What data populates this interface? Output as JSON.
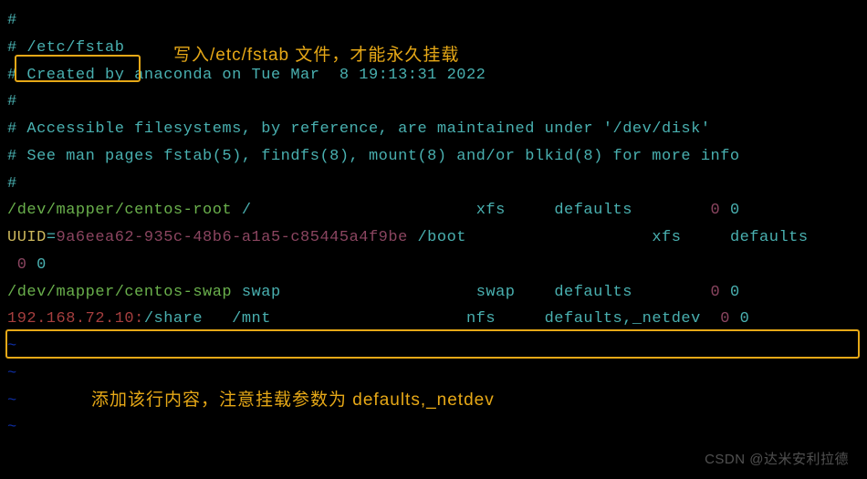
{
  "annotations": {
    "top": "写入/etc/fstab 文件，才能永久挂载",
    "bottom": "添加该行内容，注意挂载参数为 defaults,_netdev"
  },
  "lines": {
    "l1": "#",
    "l2_hash": "# ",
    "l2_path": "/etc/fstab",
    "l3": "# Created by anaconda on Tue Mar  8 19:13:31 2022",
    "l4": "#",
    "l5": "# Accessible filesystems, by reference, are maintained under '/dev/disk'",
    "l6": "# See man pages fstab(5), findfs(8), mount(8) and/or blkid(8) for more info",
    "l7": "#",
    "l8_dev": "/dev/mapper/centos-root",
    "l8_mnt": " /                       ",
    "l8_fs": "xfs     ",
    "l8_opts": "defaults        ",
    "l8_dump": "0",
    "l8_pass": " 0",
    "l9_uuid_label": "UUID",
    "l9_eq": "=",
    "l9_uuid_val": "9a6eea62-935c-48b6-a1a5-c85445a4f9be",
    "l9_mnt": " /boot                   ",
    "l9_fs": "xfs     ",
    "l9_opts": "defaults  ",
    "l10_dump": " 0",
    "l10_pass": " 0",
    "l11_dev": "/dev/mapper/centos-swap",
    "l11_mnt": " swap                    ",
    "l11_fs": "swap    ",
    "l11_opts": "defaults        ",
    "l11_dump": "0",
    "l11_pass": " 0",
    "l12_host": "192.168.72.10:",
    "l12_share": "/share   /mnt                    ",
    "l12_fs": "nfs     ",
    "l12_opts": "defaults,_netdev  ",
    "l12_dump": "0",
    "l12_pass": " 0",
    "tilde": "~"
  },
  "watermark": "CSDN @达米安利拉德"
}
